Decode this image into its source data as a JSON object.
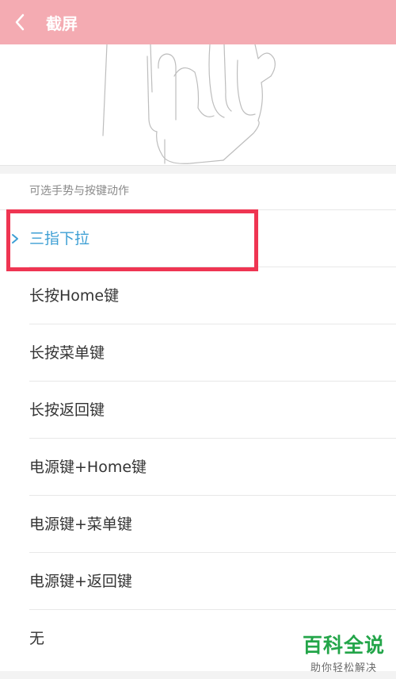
{
  "header": {
    "title": "截屏",
    "background_color": "#f4abb2"
  },
  "section": {
    "header": "可选手势与按键动作"
  },
  "options": [
    {
      "label": "三指下拉",
      "selected": true
    },
    {
      "label": "长按Home键",
      "selected": false
    },
    {
      "label": "长按菜单键",
      "selected": false
    },
    {
      "label": "长按返回键",
      "selected": false
    },
    {
      "label": "电源键+Home键",
      "selected": false
    },
    {
      "label": "电源键+菜单键",
      "selected": false
    },
    {
      "label": "电源键+返回键",
      "selected": false
    },
    {
      "label": "无",
      "selected": false
    }
  ],
  "colors": {
    "selected_text": "#3d9fd4",
    "highlight_border": "#ef3552",
    "watermark_green": "#23a549"
  },
  "watermark": {
    "title": "百科全说",
    "subtitle": "助你轻松解决"
  }
}
